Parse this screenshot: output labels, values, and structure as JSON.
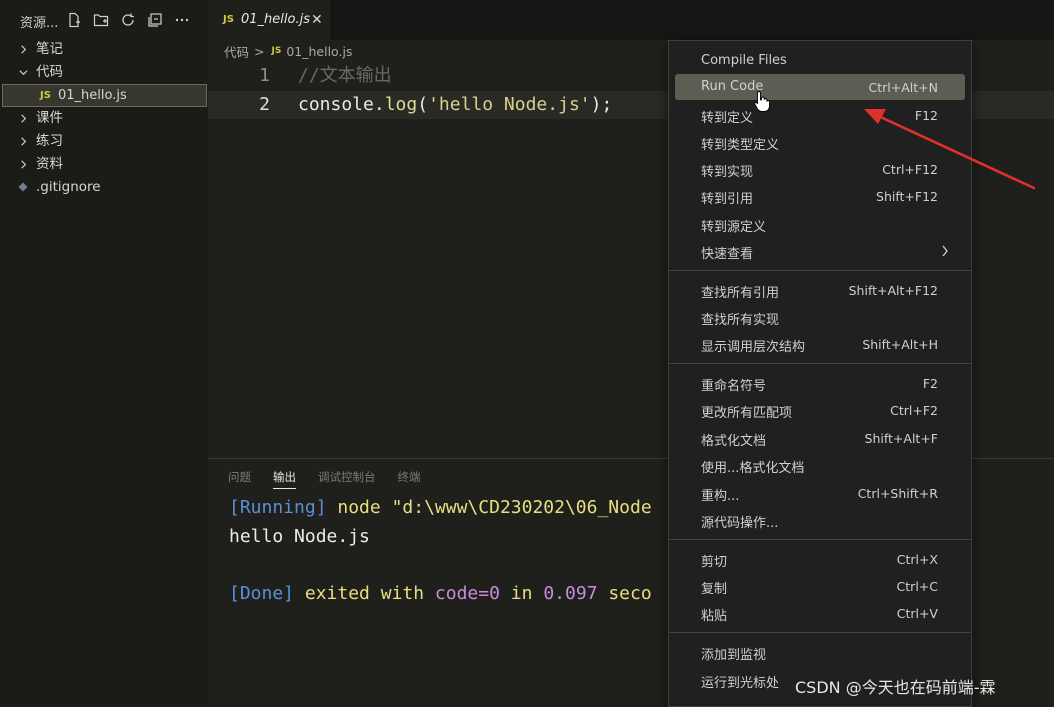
{
  "sidebar": {
    "title": "资源...",
    "items": [
      {
        "label": "笔记",
        "type": "folder",
        "expanded": false
      },
      {
        "label": "代码",
        "type": "folder",
        "expanded": true
      },
      {
        "label": "01_hello.js",
        "type": "file",
        "badge": "JS"
      },
      {
        "label": "课件",
        "type": "folder",
        "expanded": false
      },
      {
        "label": "练习",
        "type": "folder",
        "expanded": false
      },
      {
        "label": "资料",
        "type": "folder",
        "expanded": false
      },
      {
        "label": ".gitignore",
        "type": "file",
        "badge": ""
      }
    ]
  },
  "tab": {
    "badge": "JS",
    "name": "01_hello.js",
    "close": "✕"
  },
  "breadcrumb": {
    "folder": "代码",
    "sep": ">",
    "badge": "JS",
    "file": "01_hello.js"
  },
  "editor": {
    "lines": [
      {
        "num": "1",
        "comment": "//文本输出"
      },
      {
        "num": "2",
        "ident": "console",
        "dot": ".",
        "fn": "log",
        "open": "(",
        "str": "'hello Node.js'",
        "close": ");"
      }
    ]
  },
  "panel": {
    "tabs": [
      "问题",
      "输出",
      "调试控制台",
      "终端"
    ],
    "active_tab": "输出",
    "output": {
      "running_tag": "[Running]",
      "running_cmd": " node \"d:\\www\\CD230202\\06_Node",
      "hello": "hello Node.js",
      "done_tag": "[Done]",
      "exited": " exited with ",
      "code": "code=0",
      "in": " in ",
      "time": "0.097",
      "sec": " seco"
    }
  },
  "menu": {
    "items": [
      {
        "label": "Compile Files",
        "key": ""
      },
      {
        "label": "Run Code",
        "key": "Ctrl+Alt+N",
        "highlighted": true
      },
      {
        "label": "转到定义",
        "key": "F12"
      },
      {
        "label": "转到类型定义",
        "key": ""
      },
      {
        "label": "转到实现",
        "key": "Ctrl+F12"
      },
      {
        "label": "转到引用",
        "key": "Shift+F12"
      },
      {
        "label": "转到源定义",
        "key": ""
      },
      {
        "label": "快速查看",
        "key": "",
        "submenu": true
      },
      {
        "label": "查找所有引用",
        "key": "Shift+Alt+F12"
      },
      {
        "label": "查找所有实现",
        "key": ""
      },
      {
        "label": "显示调用层次结构",
        "key": "Shift+Alt+H"
      },
      {
        "label": "重命名符号",
        "key": "F2"
      },
      {
        "label": "更改所有匹配项",
        "key": "Ctrl+F2"
      },
      {
        "label": "格式化文档",
        "key": "Shift+Alt+F"
      },
      {
        "label": "使用...格式化文档",
        "key": ""
      },
      {
        "label": "重构...",
        "key": "Ctrl+Shift+R"
      },
      {
        "label": "源代码操作...",
        "key": ""
      },
      {
        "label": "剪切",
        "key": "Ctrl+X"
      },
      {
        "label": "复制",
        "key": "Ctrl+C"
      },
      {
        "label": "粘贴",
        "key": "Ctrl+V"
      },
      {
        "label": "添加到监视",
        "key": ""
      },
      {
        "label": "运行到光标处",
        "key": ""
      }
    ]
  },
  "colors": {
    "accent_arrow": "#e0302b",
    "js_badge": "#cbcb41"
  },
  "watermark": "CSDN @今天也在码前端-霖"
}
